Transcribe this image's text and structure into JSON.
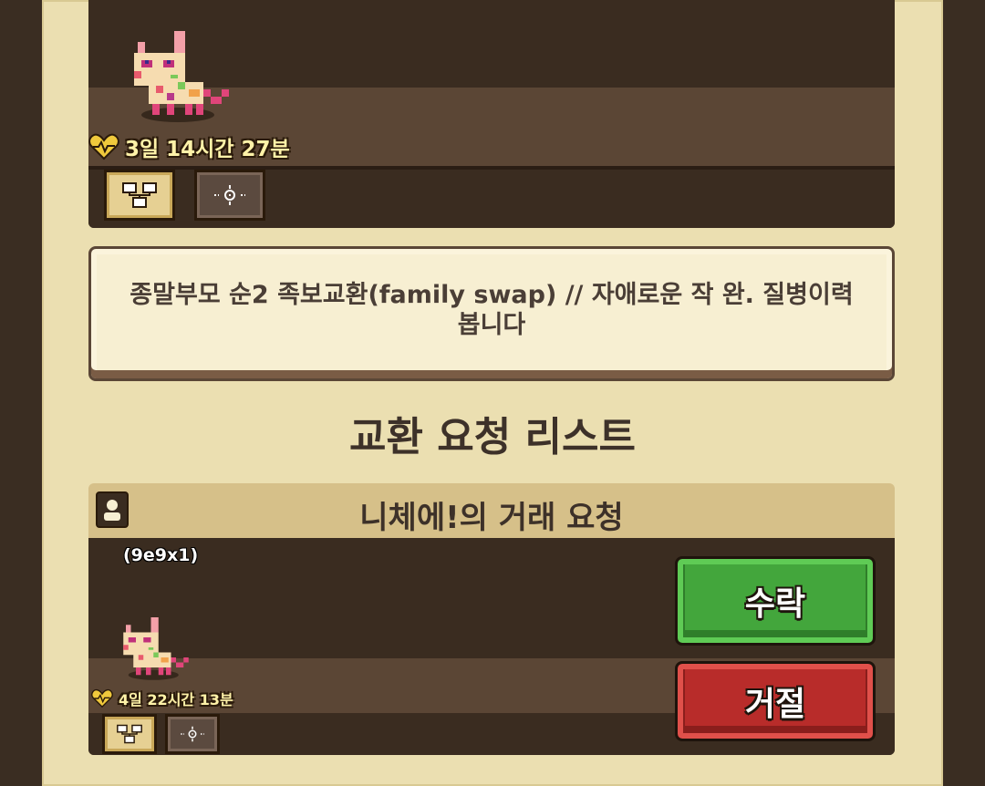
{
  "colors": {
    "frame_bg": "#ebdfb1",
    "panel_dark": "#3a2c20",
    "accept_green": "#43a63c",
    "reject_red": "#b82c2a",
    "timer_text": "#fff2a8"
  },
  "top_pet": {
    "timer": "3일 14시간 27분",
    "heart_icon": "heart-pulse-icon",
    "tree_button_icon": "family-tree-icon",
    "scan_button_icon": "target-scan-icon"
  },
  "description": {
    "line1": "종말부모 순2 족보교환(family swap) // 자애로운 작 완. 질병이력",
    "line2": "봅니다"
  },
  "section_title": "교환 요청 리스트",
  "request": {
    "title": "니체에!의 거래 요청",
    "user_icon": "user-icon",
    "pet_code": "(9e9x1)",
    "timer": "4일 22시간 13분",
    "accept_label": "수락",
    "reject_label": "거절"
  }
}
